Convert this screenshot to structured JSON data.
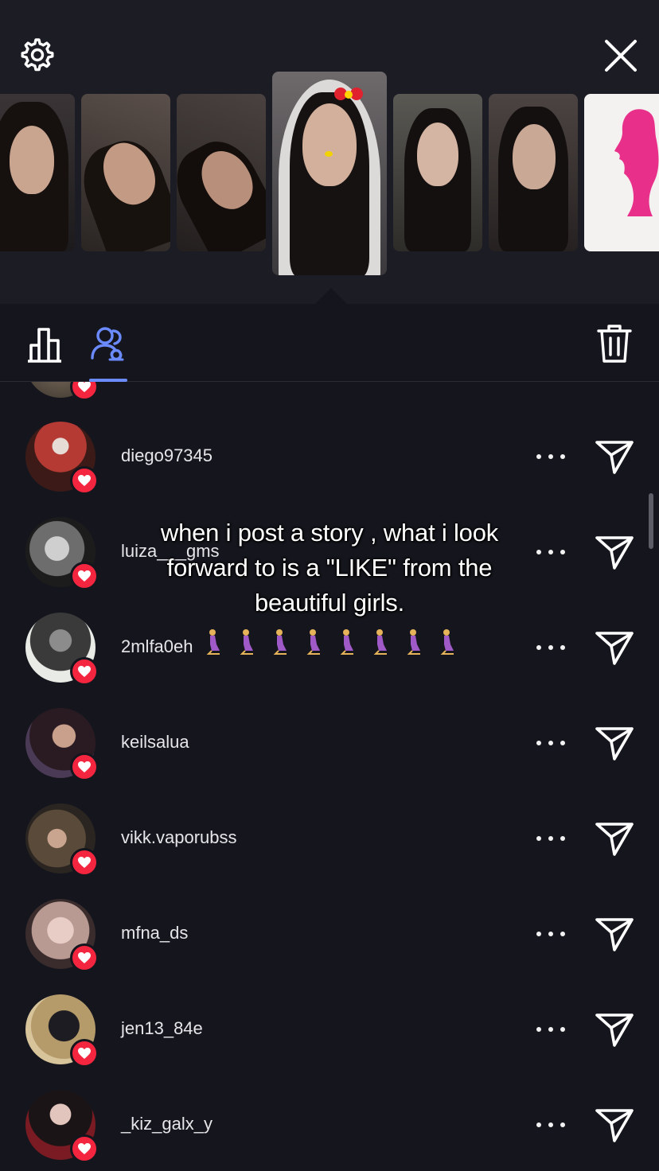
{
  "header": {
    "settings_icon": "gear-icon",
    "close_icon": "close-icon"
  },
  "tabs": [
    {
      "name": "insights",
      "icon": "bar-chart-icon",
      "active": false
    },
    {
      "name": "viewers",
      "icon": "viewers-icon",
      "active": true
    }
  ],
  "delete_icon": "trash-icon",
  "caption": "when i post a story , what i look forward to is a \"LIKE\" from the beautiful girls.",
  "viewers": [
    {
      "username": ""
    },
    {
      "username": "diego97345"
    },
    {
      "username": "luiza___gms"
    },
    {
      "username": "2mlfa0eh"
    },
    {
      "username": "keilsalua"
    },
    {
      "username": "vikk.vaporubss"
    },
    {
      "username": "mfna_ds"
    },
    {
      "username": "jen13_84e"
    },
    {
      "username": "_kiz_galx_y"
    }
  ],
  "colors": {
    "background": "#15161d",
    "header_background": "#1b1c24",
    "accent": "#6b8afd",
    "like": "#f4253f",
    "barbie_pink": "#e8308a"
  }
}
